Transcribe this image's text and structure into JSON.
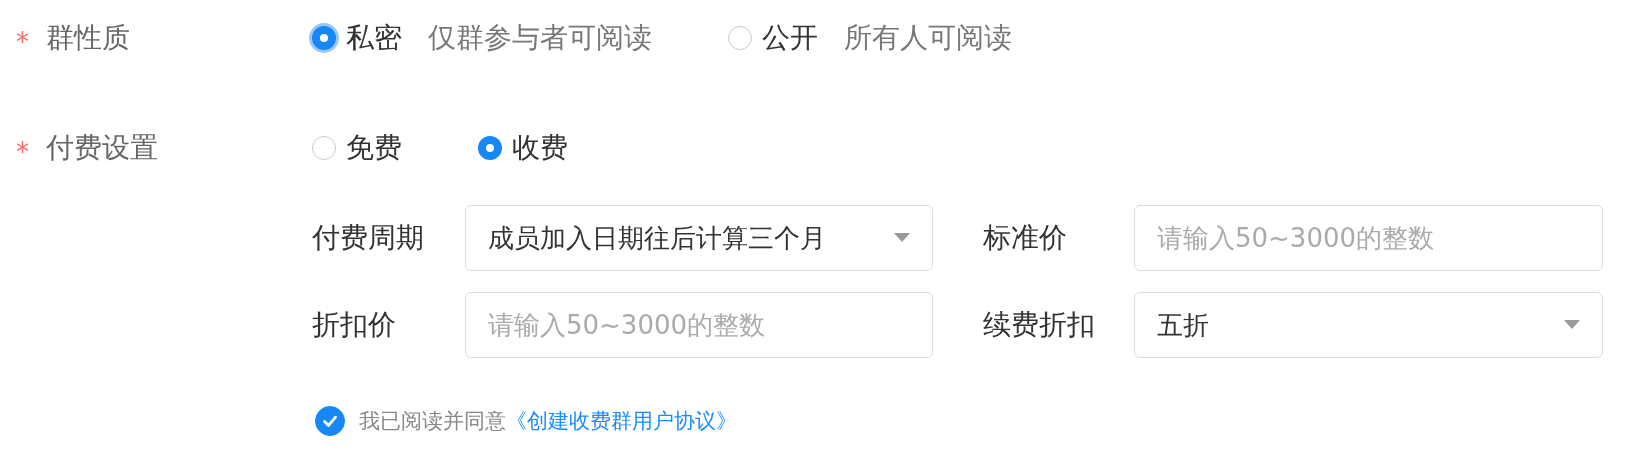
{
  "fields": [
    {
      "label": "群性质",
      "required_mark": "*",
      "options": [
        {
          "label": "私密",
          "description": "仅群参与者可阅读",
          "selected": true,
          "focused": true
        },
        {
          "label": "公开",
          "description": "所有人可阅读",
          "selected": false,
          "focused": false
        }
      ]
    },
    {
      "label": "付费设置",
      "required_mark": "*",
      "options": [
        {
          "label": "免费",
          "selected": false,
          "focused": false
        },
        {
          "label": "收费",
          "selected": true,
          "focused": false
        }
      ]
    }
  ],
  "fee_settings": [
    {
      "label": "付费周期",
      "kind": "select",
      "value": "成员加入日期往后计算三个月"
    },
    {
      "label": "标准价",
      "kind": "input",
      "placeholder": "请输入50~3000的整数"
    },
    {
      "label": "折扣价",
      "kind": "input",
      "placeholder": "请输入50~3000的整数"
    },
    {
      "label": "续费折扣",
      "kind": "select",
      "value": "五折"
    }
  ],
  "agreement": {
    "checked": true,
    "text": "我已阅读并同意",
    "link": "《创建收费群用户协议》"
  }
}
